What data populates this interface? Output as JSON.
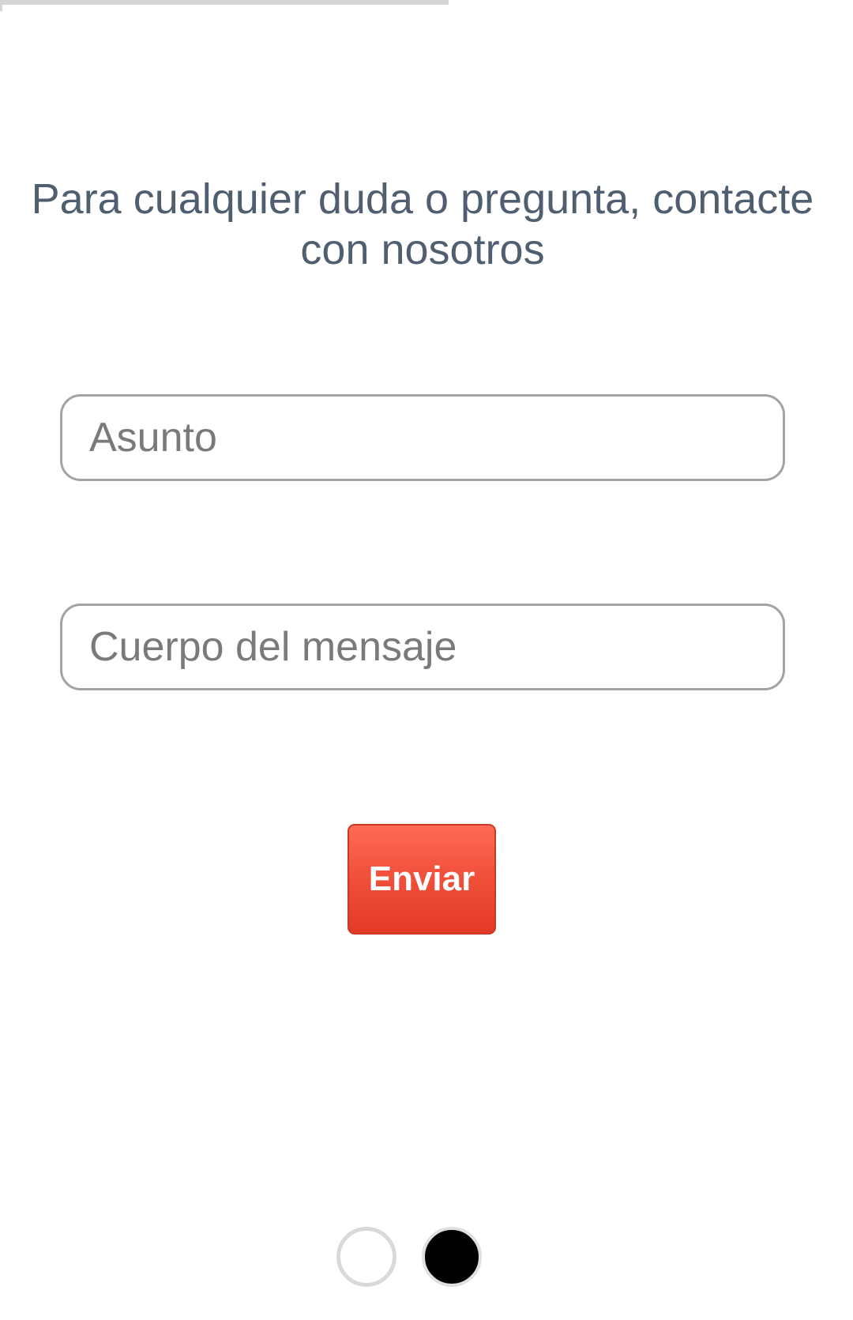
{
  "heading": {
    "line1": "Para cualquier duda o pregunta, contacte",
    "line2": "con nosotros"
  },
  "form": {
    "subject_placeholder": "Asunto",
    "subject_value": "",
    "body_placeholder": "Cuerpo del mensaje",
    "body_value": "",
    "send_label": "Enviar"
  },
  "pager": {
    "total_pages": 2,
    "current_page": 2
  },
  "colors": {
    "heading_text": "#4f5f70",
    "button_accent": "#e84a33",
    "field_border": "#a3a3a3"
  }
}
